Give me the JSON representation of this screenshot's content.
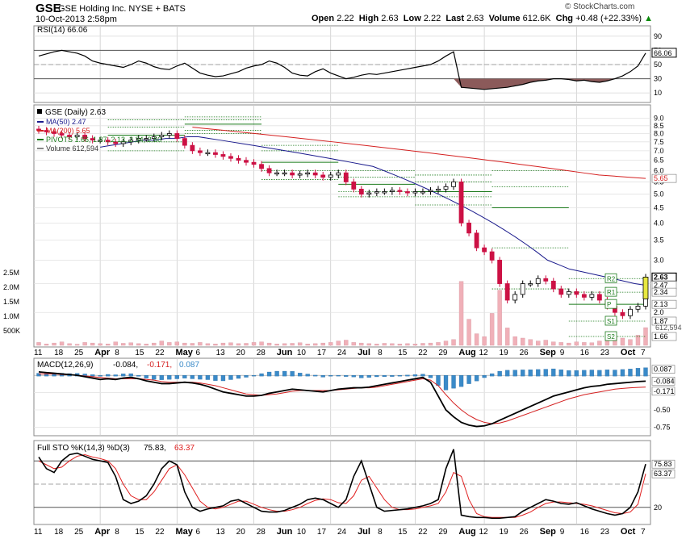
{
  "header": {
    "symbol": "GSE",
    "company": "GSE Holding Inc.  NYSE + BATS",
    "timestamp": "10-Oct-2013 2:58pm",
    "open_label": "Open",
    "open": "2.22",
    "high_label": "High",
    "high": "2.63",
    "low_label": "Low",
    "low": "2.22",
    "last_label": "Last",
    "last": "2.63",
    "volume_label": "Volume",
    "volume": "612.6K",
    "chg_label": "Chg",
    "chg": "+0.48 (+22.33%)",
    "brand": "© StockCharts.com"
  },
  "colors": {
    "up": "#000000",
    "down": "#cc1144",
    "ma50": "#1a1a8c",
    "ma200": "#d42020",
    "pivot": "#1a7a1a",
    "rsi_fill": "#8b5a5a",
    "volume": "#f0b0b8",
    "macd_hist": "#3a8ac8",
    "sto_d": "#e02020",
    "last_box": "#e8e840"
  },
  "chart_data": [
    {
      "type": "line",
      "title": "RSI(14) 66.06",
      "y_ticks": [
        "90",
        "70",
        "50",
        "30",
        "10"
      ],
      "levels": [
        70,
        30
      ],
      "ylim": [
        0,
        100
      ],
      "last_value_label": "66.06",
      "series": [
        {
          "name": "RSI(14)",
          "values": [
            62,
            65,
            68,
            70,
            68,
            66,
            62,
            55,
            52,
            50,
            48,
            46,
            50,
            55,
            52,
            47,
            44,
            43,
            48,
            52,
            45,
            38,
            35,
            33,
            34,
            37,
            40,
            45,
            48,
            50,
            55,
            52,
            46,
            38,
            35,
            34,
            40,
            44,
            38,
            34,
            30,
            32,
            35,
            37,
            36,
            38,
            40,
            42,
            44,
            46,
            48,
            50,
            55,
            62,
            68,
            18,
            17,
            16,
            15,
            16,
            17,
            18,
            20,
            22,
            25,
            27,
            28,
            30,
            30,
            29,
            27,
            28,
            26,
            25,
            27,
            30,
            34,
            40,
            48,
            66.06
          ]
        }
      ]
    },
    {
      "type": "candlestick",
      "title": "GSE (Daily) 2.63",
      "legend": [
        "MA(50) 2.47",
        "MA(200) 5.65",
        "PIVOTS 1.66, 1.87, 2.13, 2.34, 2.60",
        "Volume 612,594"
      ],
      "scale": "log",
      "ylim": [
        1.55,
        9.5
      ],
      "y_ticks": [
        "9.0",
        "8.5",
        "8.0",
        "7.5",
        "7.0",
        "6.5",
        "6.0",
        "5.5",
        "5.0",
        "4.5",
        "4.0",
        "3.5",
        "3.0",
        "2.5",
        "2.0"
      ],
      "volume_ticks": [
        "2.5M",
        "2.0M",
        "1.5M",
        "1.0M",
        "500K"
      ],
      "pivot_labels": [
        "R2",
        "R1",
        "P",
        "S1",
        "S2"
      ],
      "price_tags": [
        "2.63",
        "2.47",
        "2.34",
        "2.13",
        "1.87",
        "1.66",
        "5.65"
      ],
      "vol_tag": "612,594",
      "close": [
        8.2,
        8.1,
        8.0,
        7.9,
        7.8,
        7.9,
        7.7,
        7.6,
        7.6,
        7.5,
        7.4,
        7.5,
        7.6,
        7.7,
        7.7,
        7.8,
        7.9,
        8.0,
        7.7,
        7.3,
        7.0,
        6.9,
        6.9,
        6.8,
        6.7,
        6.6,
        6.5,
        6.4,
        6.3,
        6.1,
        5.9,
        5.9,
        5.9,
        5.8,
        5.85,
        5.9,
        5.8,
        5.7,
        5.8,
        5.9,
        5.5,
        5.2,
        5.0,
        5.05,
        5.1,
        5.1,
        5.15,
        5.1,
        5.05,
        5.1,
        5.1,
        5.15,
        5.2,
        5.3,
        5.5,
        4.0,
        3.7,
        3.3,
        3.2,
        3.0,
        2.5,
        2.2,
        2.3,
        2.5,
        2.5,
        2.6,
        2.55,
        2.4,
        2.3,
        2.35,
        2.3,
        2.25,
        2.3,
        2.2,
        2.1,
        2.0,
        1.95,
        2.05,
        2.1,
        2.63
      ],
      "volume": [
        0.1,
        0.05,
        0.08,
        0.12,
        0.06,
        0.04,
        0.1,
        0.08,
        0.06,
        0.05,
        0.12,
        0.07,
        0.09,
        0.06,
        0.05,
        0.08,
        0.15,
        0.1,
        0.12,
        0.08,
        0.07,
        0.1,
        0.06,
        0.05,
        0.08,
        0.09,
        0.06,
        0.07,
        0.1,
        0.12,
        0.08,
        0.05,
        0.06,
        0.07,
        0.09,
        0.05,
        0.06,
        0.08,
        0.1,
        0.15,
        0.18,
        0.1,
        0.08,
        0.06,
        0.05,
        0.07,
        0.06,
        0.05,
        0.06,
        0.05,
        0.07,
        0.08,
        0.1,
        0.15,
        0.2,
        2.2,
        0.9,
        0.4,
        0.3,
        1.1,
        1.9,
        0.6,
        0.3,
        0.25,
        0.2,
        0.15,
        0.18,
        0.12,
        0.1,
        0.08,
        0.12,
        0.1,
        0.09,
        0.15,
        0.2,
        0.3,
        0.25,
        0.2,
        0.35,
        0.61
      ],
      "ma50": [
        7.2,
        7.3,
        7.4,
        7.5,
        7.6,
        7.6,
        7.7,
        7.7,
        7.8,
        7.8,
        7.7,
        7.6,
        7.5,
        7.4,
        7.3,
        7.2,
        7.1,
        7.0,
        6.9,
        6.8,
        6.7,
        6.6,
        6.5,
        6.4,
        6.3,
        6.2,
        6.0,
        5.8,
        5.6,
        5.4,
        5.2,
        5.0,
        4.8,
        4.6,
        4.4,
        4.2,
        4.0,
        3.8,
        3.6,
        3.4,
        3.2,
        3.0,
        2.9,
        2.8,
        2.75,
        2.7,
        2.65,
        2.6,
        2.55,
        2.5,
        2.47
      ],
      "ma200": [
        8.4,
        8.3,
        8.2,
        8.1,
        8.0,
        7.9,
        7.8,
        7.7,
        7.6,
        7.5,
        7.4,
        7.3,
        7.2,
        7.1,
        7.0,
        6.9,
        6.8,
        6.7,
        6.6,
        6.5,
        6.4,
        6.3,
        6.2,
        6.1,
        6.0,
        5.9,
        5.8,
        5.75,
        5.7,
        5.65
      ],
      "pivots": [
        {
          "x0": 9,
          "x1": 19,
          "levels": [
            7.0,
            7.5,
            7.9,
            8.4,
            8.9
          ]
        },
        {
          "x0": 19,
          "x1": 29,
          "levels": [
            8.0,
            8.2,
            8.6,
            8.9,
            9.1
          ]
        },
        {
          "x0": 29,
          "x1": 39,
          "levels": [
            5.6,
            6.0,
            6.4,
            7.0,
            7.3
          ]
        },
        {
          "x0": 39,
          "x1": 49,
          "levels": [
            4.9,
            5.1,
            5.4,
            5.7,
            6.0
          ]
        },
        {
          "x0": 49,
          "x1": 59,
          "levels": [
            4.6,
            4.9,
            5.1,
            5.5,
            5.8
          ]
        },
        {
          "x0": 59,
          "x1": 69,
          "levels": [
            2.4,
            3.3,
            4.5,
            5.3,
            6.0
          ]
        },
        {
          "x0": 69,
          "x1": 79,
          "levels": [
            1.66,
            1.87,
            2.13,
            2.34,
            2.6
          ]
        }
      ]
    },
    {
      "type": "line",
      "title": "MACD(12,26,9) -0.084, -0.171, 0.087",
      "title_parts": [
        "MACD(12,26,9)",
        " -0.084,",
        " -0.171,",
        " 0.087"
      ],
      "ylim": [
        -0.85,
        0.2
      ],
      "y_ticks": [
        "-0.25",
        "-0.50",
        "-0.75"
      ],
      "value_tags": [
        "0.087",
        "-0.084",
        "-0.171"
      ],
      "series": [
        {
          "name": "MACD",
          "values": [
            0.05,
            0.04,
            0.03,
            0.02,
            0.01,
            0.0,
            -0.02,
            -0.04,
            -0.06,
            -0.05,
            -0.06,
            -0.04,
            -0.03,
            -0.05,
            -0.08,
            -0.1,
            -0.12,
            -0.12,
            -0.11,
            -0.1,
            -0.11,
            -0.13,
            -0.16,
            -0.2,
            -0.24,
            -0.26,
            -0.28,
            -0.3,
            -0.3,
            -0.29,
            -0.26,
            -0.24,
            -0.22,
            -0.2,
            -0.21,
            -0.22,
            -0.23,
            -0.24,
            -0.22,
            -0.2,
            -0.19,
            -0.18,
            -0.18,
            -0.17,
            -0.15,
            -0.13,
            -0.11,
            -0.09,
            -0.07,
            -0.05,
            -0.03,
            -0.1,
            -0.3,
            -0.5,
            -0.6,
            -0.68,
            -0.72,
            -0.74,
            -0.73,
            -0.7,
            -0.65,
            -0.6,
            -0.55,
            -0.5,
            -0.45,
            -0.4,
            -0.35,
            -0.3,
            -0.27,
            -0.24,
            -0.21,
            -0.18,
            -0.16,
            -0.15,
            -0.13,
            -0.12,
            -0.11,
            -0.1,
            -0.09,
            -0.084
          ]
        },
        {
          "name": "Signal",
          "values": [
            0.02,
            0.02,
            0.02,
            0.01,
            0.01,
            0.0,
            -0.01,
            -0.02,
            -0.03,
            -0.04,
            -0.05,
            -0.05,
            -0.05,
            -0.05,
            -0.06,
            -0.07,
            -0.09,
            -0.1,
            -0.1,
            -0.1,
            -0.1,
            -0.11,
            -0.13,
            -0.15,
            -0.18,
            -0.21,
            -0.24,
            -0.27,
            -0.28,
            -0.29,
            -0.28,
            -0.27,
            -0.25,
            -0.23,
            -0.22,
            -0.22,
            -0.22,
            -0.22,
            -0.22,
            -0.21,
            -0.2,
            -0.19,
            -0.18,
            -0.18,
            -0.17,
            -0.15,
            -0.13,
            -0.11,
            -0.09,
            -0.07,
            -0.05,
            -0.07,
            -0.15,
            -0.28,
            -0.4,
            -0.5,
            -0.58,
            -0.64,
            -0.68,
            -0.7,
            -0.69,
            -0.66,
            -0.62,
            -0.58,
            -0.54,
            -0.5,
            -0.46,
            -0.42,
            -0.38,
            -0.34,
            -0.31,
            -0.28,
            -0.26,
            -0.24,
            -0.22,
            -0.2,
            -0.19,
            -0.18,
            -0.175,
            -0.171
          ]
        }
      ]
    },
    {
      "type": "line",
      "title": "Full STO %K(14,3) %D(3) 75.83, 63.37",
      "title_parts": [
        "Full STO %K(14,3) %D(3)",
        " 75.83,",
        " 63.37"
      ],
      "ylim": [
        0,
        100
      ],
      "levels": [
        80,
        20
      ],
      "y_ticks": [
        "20"
      ],
      "value_tags": [
        "75.83",
        "63.37"
      ],
      "series": [
        {
          "name": "%K",
          "values": [
            85,
            70,
            65,
            80,
            88,
            90,
            86,
            82,
            80,
            78,
            60,
            30,
            25,
            28,
            35,
            50,
            70,
            80,
            75,
            40,
            20,
            15,
            18,
            20,
            22,
            28,
            30,
            25,
            20,
            15,
            14,
            14,
            16,
            20,
            24,
            30,
            32,
            30,
            25,
            20,
            30,
            60,
            80,
            50,
            20,
            15,
            16,
            17,
            18,
            20,
            22,
            25,
            30,
            70,
            95,
            10,
            8,
            7,
            7,
            6,
            6,
            7,
            8,
            15,
            20,
            25,
            30,
            28,
            25,
            24,
            26,
            22,
            18,
            15,
            12,
            10,
            12,
            20,
            40,
            75.83
          ]
        },
        {
          "name": "%D",
          "values": [
            80,
            75,
            70,
            72,
            80,
            86,
            88,
            85,
            83,
            80,
            70,
            50,
            35,
            30,
            30,
            40,
            55,
            70,
            75,
            62,
            45,
            28,
            20,
            18,
            20,
            24,
            28,
            28,
            24,
            20,
            17,
            15,
            15,
            17,
            20,
            25,
            29,
            31,
            30,
            26,
            25,
            35,
            55,
            60,
            45,
            30,
            20,
            17,
            17,
            18,
            20,
            22,
            25,
            40,
            65,
            60,
            30,
            12,
            8,
            7,
            7,
            7,
            7,
            10,
            14,
            20,
            25,
            27,
            27,
            26,
            25,
            24,
            22,
            19,
            16,
            13,
            12,
            14,
            24,
            63.37
          ]
        }
      ]
    }
  ],
  "x_axis": {
    "labels": [
      "11",
      "18",
      "25",
      "Apr",
      "8",
      "15",
      "22",
      "May",
      "6",
      "13",
      "20",
      "28",
      "Jun",
      "10",
      "17",
      "24",
      "Jul",
      "8",
      "15",
      "22",
      "29",
      "Aug",
      "12",
      "19",
      "26",
      "Sep",
      "9",
      "16",
      "23",
      "Oct",
      "7"
    ],
    "month_labels": [
      "Apr",
      "May",
      "Jun",
      "Jul",
      "Aug",
      "Sep",
      "Oct"
    ]
  }
}
